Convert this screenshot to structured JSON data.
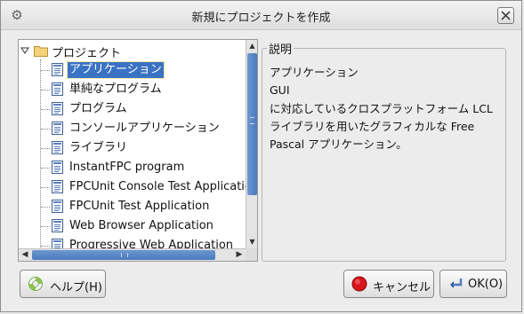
{
  "window": {
    "title": "新規にプロジェクトを作成",
    "app_icon": "gear-icon",
    "close_icon": "close-icon"
  },
  "tree": {
    "root_label": "プロジェクト",
    "items": [
      {
        "label": "アプリケーション",
        "selected": true
      },
      {
        "label": "単純なプログラム"
      },
      {
        "label": "プログラム"
      },
      {
        "label": "コンソールアプリケーション"
      },
      {
        "label": "ライブラリ"
      },
      {
        "label": "InstantFPC program"
      },
      {
        "label": "FPCUnit Console Test Application"
      },
      {
        "label": "FPCUnit Test Application"
      },
      {
        "label": "Web Browser Application"
      },
      {
        "label": "Progressive Web Application"
      }
    ]
  },
  "description": {
    "legend": "説明",
    "lines": [
      "アプリケーション",
      "GUI",
      "に対応しているクロスプラットフォーム LCL",
      "ライブラリを用いたグラフィカルな Free",
      "Pascal アプリケーション。"
    ]
  },
  "buttons": {
    "help": "ヘルプ(H)",
    "cancel": "キャンセル",
    "ok": "OK(O)"
  },
  "colors": {
    "selection": "#3b73c4",
    "scroll_thumb": "#4a79bd",
    "cancel_icon": "#d9141b"
  }
}
